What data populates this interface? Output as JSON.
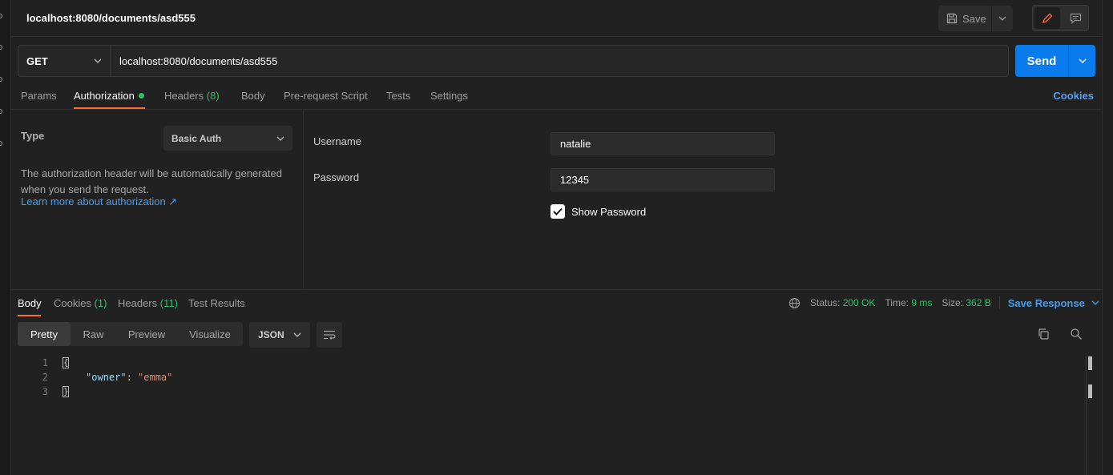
{
  "request": {
    "title": "localhost:8080/documents/asd555",
    "save_label": "Save",
    "method": "GET",
    "url": "localhost:8080/documents/asd555",
    "send_label": "Send"
  },
  "request_tabs": {
    "params": "Params",
    "authorization": "Authorization",
    "headers": "Headers",
    "headers_count": "(8)",
    "body": "Body",
    "prerequest": "Pre-request Script",
    "tests": "Tests",
    "settings": "Settings",
    "cookies": "Cookies"
  },
  "auth": {
    "type_label": "Type",
    "type_value": "Basic Auth",
    "description": "The authorization header will be automatically generated when you send the request.",
    "learn_more": "Learn more about authorization ↗",
    "username_label": "Username",
    "username_value": "natalie",
    "password_label": "Password",
    "password_value": "12345",
    "show_password_label": "Show Password",
    "show_password_checked": true
  },
  "response_tabs": {
    "body": "Body",
    "cookies": "Cookies",
    "cookies_count": "(1)",
    "headers": "Headers",
    "headers_count": "(11)",
    "test_results": "Test Results"
  },
  "response_status": {
    "status_label": "Status:",
    "status_value": "200 OK",
    "time_label": "Time:",
    "time_value": "9 ms",
    "size_label": "Size:",
    "size_value": "362 B",
    "save_response": "Save Response"
  },
  "format": {
    "pretty": "Pretty",
    "raw": "Raw",
    "preview": "Preview",
    "visualize": "Visualize",
    "language": "JSON"
  },
  "code": {
    "line_numbers": [
      "1",
      "2",
      "3"
    ],
    "key": "\"owner\"",
    "colon": ": ",
    "value": "\"emma\""
  },
  "colors": {
    "accent_orange": "#ff6c37",
    "send_blue": "#097bed",
    "success_green": "#2fbf71",
    "link_blue": "#4a9de8"
  }
}
